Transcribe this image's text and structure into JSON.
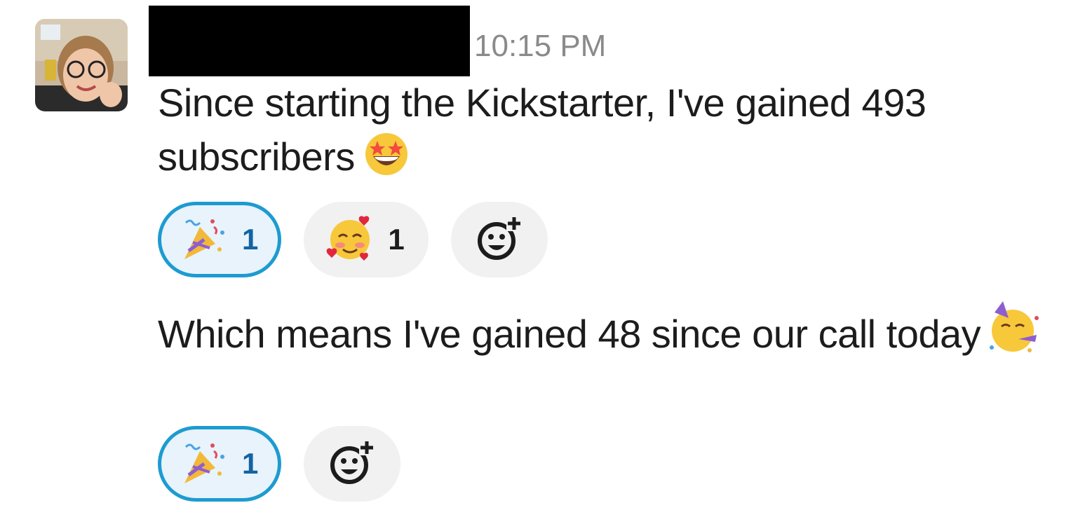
{
  "message": {
    "timestamp": "10:15 PM",
    "lines": [
      {
        "text": "Since starting the Kickstarter, I've gained 493 subscribers",
        "emoji": "star-struck",
        "reactions": [
          {
            "emoji": "party-popper",
            "count": "1",
            "active": true
          },
          {
            "emoji": "smiling-face-with-hearts",
            "count": "1",
            "active": false
          }
        ]
      },
      {
        "text": "Which means I've gained 48 since our call today",
        "emoji": "partying-face",
        "reactions": [
          {
            "emoji": "party-popper",
            "count": "1",
            "active": true
          }
        ]
      }
    ]
  },
  "colors": {
    "active_border": "#1d9bd1",
    "active_bg": "#e8f3fb",
    "active_count": "#1264a3",
    "pill_bg": "#f1f1f1",
    "timestamp": "#8a8a8a"
  }
}
